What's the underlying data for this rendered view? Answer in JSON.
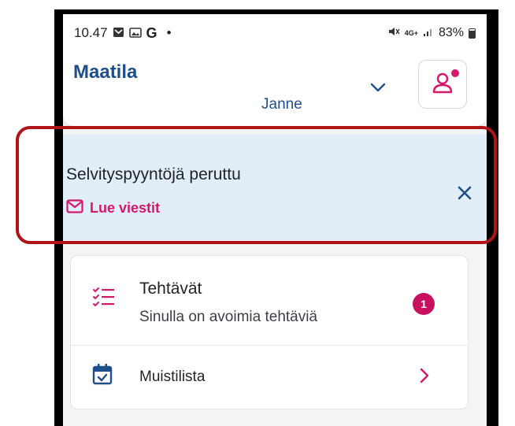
{
  "status_bar": {
    "time": "10.47",
    "left_icons": [
      "mail-icon",
      "photo-icon",
      "google-icon"
    ],
    "google_letter": "G",
    "dot": "•",
    "network": "4G+",
    "battery_text": "83%"
  },
  "header": {
    "app_title": "Maatila",
    "user_name": "Janne"
  },
  "banner": {
    "title": "Selvityspyyntöjä peruttu",
    "link_label": "Lue viestit"
  },
  "tasks": {
    "title": "Tehtävät",
    "subtitle": "Sinulla on avoimia tehtäviä",
    "badge_count": "1"
  },
  "memo": {
    "label": "Muistilista"
  },
  "colors": {
    "brand_blue": "#1e4e8c",
    "accent_pink": "#d6186a",
    "banner_bg": "#e1eef7",
    "highlight_red": "#b01417"
  }
}
